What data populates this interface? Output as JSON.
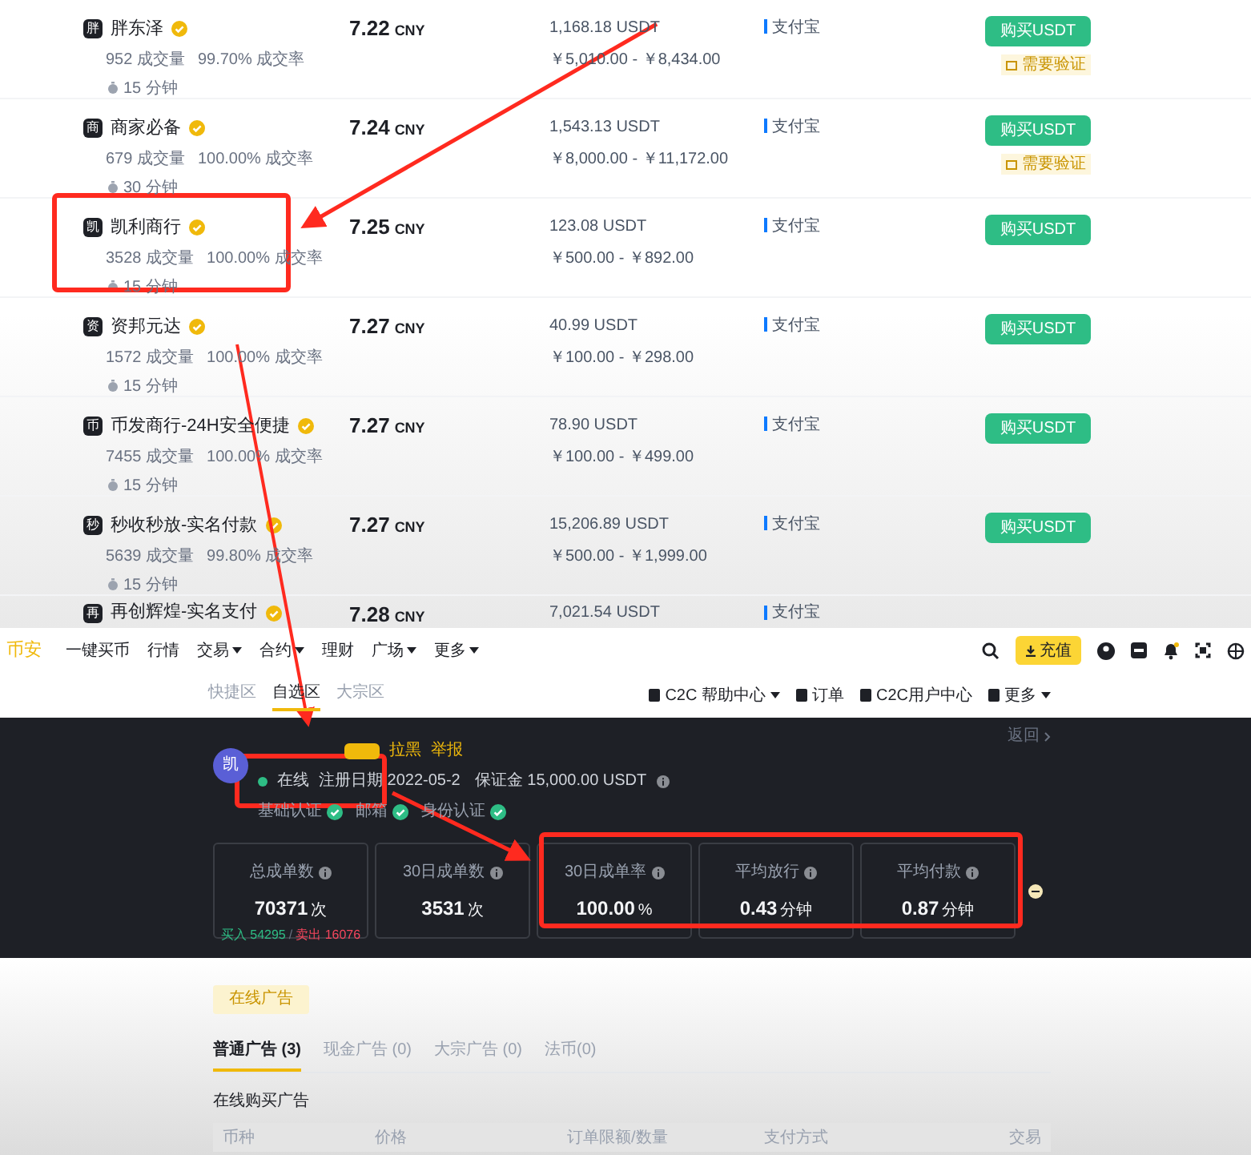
{
  "listings": [
    {
      "name": "胖东泽",
      "avatar": "胖",
      "volume": "952 成交量",
      "rate": "99.70% 成交率",
      "time": "15 分钟",
      "price": "7.22",
      "currency": "CNY",
      "available": "1,168.18 USDT",
      "limit": "￥5,010.00 - ￥8,434.00",
      "payment": "支付宝",
      "button": "购买USDT",
      "verify": "需要验证"
    },
    {
      "name": "商家必备",
      "avatar": "商",
      "volume": "679 成交量",
      "rate": "100.00% 成交率",
      "time": "30 分钟",
      "price": "7.24",
      "currency": "CNY",
      "available": "1,543.13 USDT",
      "limit": "￥8,000.00 - ￥11,172.00",
      "payment": "支付宝",
      "button": "购买USDT",
      "verify": "需要验证"
    },
    {
      "name": "凯利商行",
      "avatar": "凯",
      "volume": "3528 成交量",
      "rate": "100.00% 成交率",
      "time": "15 分钟",
      "price": "7.25",
      "currency": "CNY",
      "available": "123.08 USDT",
      "limit": "￥500.00 - ￥892.00",
      "payment": "支付宝",
      "button": "购买USDT"
    },
    {
      "name": "资邦元达",
      "avatar": "资",
      "volume": "1572 成交量",
      "rate": "100.00% 成交率",
      "time": "15 分钟",
      "price": "7.27",
      "currency": "CNY",
      "available": "40.99 USDT",
      "limit": "￥100.00 - ￥298.00",
      "payment": "支付宝",
      "button": "购买USDT"
    },
    {
      "name": "币发商行-24H安全便捷",
      "avatar": "币",
      "volume": "7455 成交量",
      "rate": "100.00% 成交率",
      "time": "15 分钟",
      "price": "7.27",
      "currency": "CNY",
      "available": "78.90 USDT",
      "limit": "￥100.00 - ￥499.00",
      "payment": "支付宝",
      "button": "购买USDT"
    },
    {
      "name": "秒收秒放-实名付款",
      "avatar": "秒",
      "volume": "5639 成交量",
      "rate": "99.80% 成交率",
      "time": "15 分钟",
      "price": "7.27",
      "currency": "CNY",
      "available": "15,206.89 USDT",
      "limit": "￥500.00 - ￥1,999.00",
      "payment": "支付宝",
      "button": "购买USDT"
    },
    {
      "name": "再创辉煌-实名支付",
      "avatar": "再",
      "price": "7.28",
      "currency": "CNY",
      "available": "7,021.54 USDT",
      "payment": "支付宝"
    }
  ],
  "nav": {
    "logo": "币安",
    "items": [
      {
        "label": "一键买币",
        "dropdown": false
      },
      {
        "label": "行情",
        "dropdown": false
      },
      {
        "label": "交易",
        "dropdown": true
      },
      {
        "label": "合约",
        "dropdown": true
      },
      {
        "label": "理财",
        "dropdown": false
      },
      {
        "label": "广场",
        "dropdown": true
      },
      {
        "label": "更多",
        "dropdown": true
      }
    ],
    "deposit": "充值"
  },
  "subnav": {
    "tabs": [
      {
        "label": "快捷区",
        "selected": false
      },
      {
        "label": "自选区",
        "selected": true
      },
      {
        "label": "大宗区",
        "selected": false
      }
    ],
    "links": [
      {
        "label": "C2C 帮助中心",
        "dropdown": true
      },
      {
        "label": "订单",
        "dropdown": false
      },
      {
        "label": "C2C用户中心",
        "dropdown": false
      },
      {
        "label": "更多",
        "dropdown": true
      }
    ]
  },
  "profile": {
    "avatar": "凯",
    "back": "返回",
    "actions": [
      "拉黑",
      "举报"
    ],
    "status": "在线",
    "registered": "注册日期 2022-05-2",
    "deposit": "保证金 15,000.00 USDT",
    "verifications": [
      "基础认证",
      "邮箱",
      "身份认证"
    ],
    "stats": [
      {
        "label": "总成单数",
        "value": "70371",
        "unit": "次",
        "buy": "买入 54295",
        "divider": "/",
        "sell": "卖出 16076"
      },
      {
        "label": "30日成单数",
        "value": "3531",
        "unit": "次"
      },
      {
        "label": "30日成单率",
        "value": "100.00",
        "unit": "%"
      },
      {
        "label": "平均放行",
        "value": "0.43",
        "unit": "分钟"
      },
      {
        "label": "平均付款",
        "value": "0.87",
        "unit": "分钟"
      }
    ]
  },
  "ads": {
    "button": "在线广告",
    "tabs": [
      {
        "label": "普通广告 (3)",
        "selected": true
      },
      {
        "label": "现金广告 (0)",
        "selected": false
      },
      {
        "label": "大宗广告 (0)",
        "selected": false
      },
      {
        "label": "法币(0)",
        "selected": false
      }
    ],
    "heading": "在线购买广告",
    "columns": [
      "币种",
      "价格",
      "订单限额/数量",
      "支付方式",
      "交易"
    ]
  }
}
